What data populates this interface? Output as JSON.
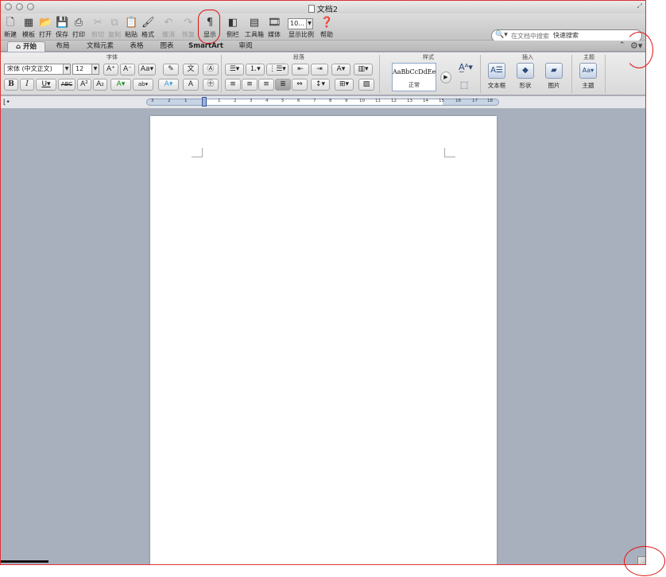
{
  "window": {
    "title": "文档2"
  },
  "toolbar": {
    "buttons": [
      {
        "label": "新建",
        "icon": "new-document-icon"
      },
      {
        "label": "模板",
        "icon": "template-gallery-icon"
      },
      {
        "label": "打开",
        "icon": "open-folder-icon"
      },
      {
        "label": "保存",
        "icon": "save-disk-icon"
      },
      {
        "label": "打印",
        "icon": "printer-icon"
      },
      {
        "label": "剪切",
        "icon": "scissors-icon"
      },
      {
        "label": "复制",
        "icon": "copy-icon"
      },
      {
        "label": "粘贴",
        "icon": "paste-clipboard-icon"
      },
      {
        "label": "格式",
        "icon": "format-painter-icon"
      },
      {
        "label": "撤消",
        "icon": "undo-icon"
      },
      {
        "label": "恢复",
        "icon": "redo-icon"
      },
      {
        "label": "显示",
        "icon": "show-formatting-icon"
      },
      {
        "label": "侧栏",
        "icon": "sidebar-icon"
      },
      {
        "label": "工具箱",
        "icon": "toolbox-icon"
      },
      {
        "label": "媒体",
        "icon": "media-browser-icon"
      },
      {
        "label": "显示比例",
        "icon": "zoom-icon"
      },
      {
        "label": "帮助",
        "icon": "help-icon"
      }
    ],
    "zoom_value": "10...",
    "search_placeholder": "在文档中搜索",
    "search_label": "快速搜索"
  },
  "tabs": [
    "开始",
    "布局",
    "文档元素",
    "表格",
    "图表",
    "SmartArt",
    "审阅"
  ],
  "active_tab": "开始",
  "ribbon": {
    "groups": {
      "font": "字体",
      "paragraph": "段落",
      "styles": "样式",
      "insert": "插入",
      "themes": "主题"
    },
    "font_name": "宋体 (中文正文)",
    "font_size": "12",
    "style_sample": "AaBbCcDdEe",
    "style_name": "正常",
    "insert_buttons": [
      "文本框",
      "形状",
      "图片"
    ],
    "theme_button": "主题"
  },
  "ruler": {
    "ticks": [
      "3",
      "2",
      "1",
      "1",
      "2",
      "3",
      "4",
      "5",
      "6",
      "7",
      "8",
      "9",
      "10",
      "11",
      "12",
      "13",
      "14",
      "15",
      "16",
      "17",
      "18"
    ]
  },
  "colors": {
    "annotation": "#e01010",
    "document_area": "#a9b0bd",
    "page": "#ffffff",
    "ruler_margin": "#c7d4e6"
  }
}
